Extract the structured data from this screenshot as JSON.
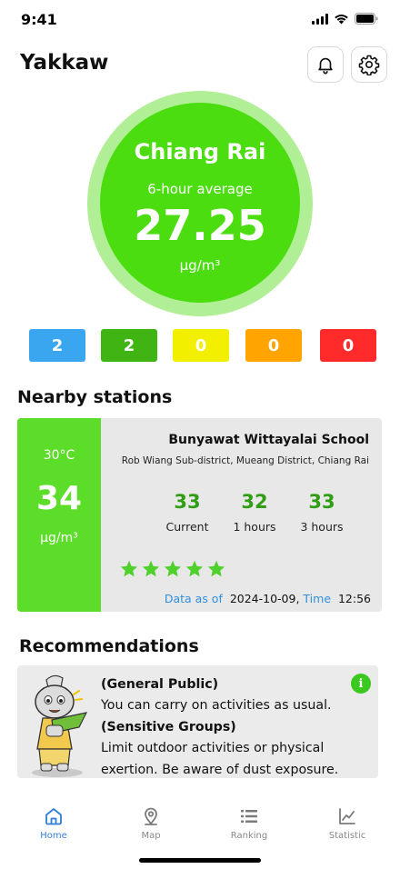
{
  "status_bar": {
    "time": "9:41"
  },
  "app": {
    "title": "Yakkaw"
  },
  "aqi": {
    "city": "Chiang Rai",
    "average_label": "6-hour average",
    "value": "27.25",
    "unit": "μg/m³",
    "color": "#4cdd11"
  },
  "level_counts": [
    {
      "count": "2",
      "color": "#3aa6f0"
    },
    {
      "count": "2",
      "color": "#3fb412"
    },
    {
      "count": "0",
      "color": "#f2f000"
    },
    {
      "count": "0",
      "color": "#ffa400"
    },
    {
      "count": "0",
      "color": "#ff2b2b"
    }
  ],
  "nearby": {
    "title": "Nearby stations",
    "station": {
      "temperature": "30°C",
      "value": "34",
      "unit": "μg/m³",
      "name": "Bunyawat Wittayalai School",
      "address": "Rob Wiang Sub-district, Mueang District, Chiang Rai",
      "readings": [
        {
          "value": "33",
          "label": "Current"
        },
        {
          "value": "32",
          "label": "1 hours"
        },
        {
          "value": "33",
          "label": "3 hours"
        }
      ],
      "rating_stars": 5,
      "data_as_of_label": "Data as of",
      "date": "2024-10-09,",
      "time_label": "Time",
      "time": "12:56"
    }
  },
  "recommendations": {
    "title": "Recommendations",
    "general_heading": "(General Public)",
    "general_text": "You can carry on activities as usual.",
    "sensitive_heading": "(Sensitive Groups)",
    "sensitive_text": "Limit outdoor activities or physical exertion. Be aware of dust exposure."
  },
  "nav": {
    "items": [
      {
        "label": "Home",
        "icon": "home-icon",
        "active": true
      },
      {
        "label": "Map",
        "icon": "map-pin-icon"
      },
      {
        "label": "Ranking",
        "icon": "list-icon"
      },
      {
        "label": "Statistic",
        "icon": "chart-icon"
      }
    ]
  }
}
